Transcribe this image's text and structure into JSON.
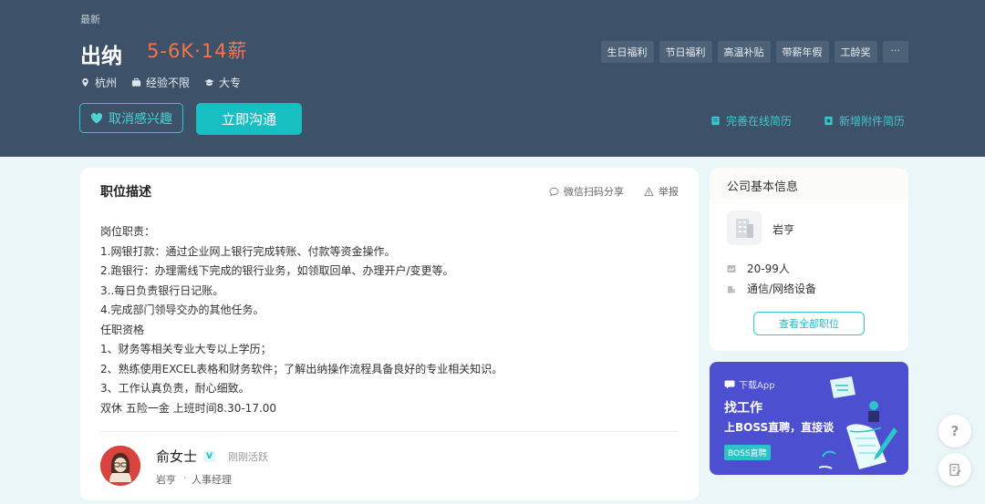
{
  "header": {
    "badge": "最新",
    "title": "出纳",
    "salary": "5-6K·14薪",
    "tags": [
      "生日福利",
      "节日福利",
      "高温补贴",
      "带薪年假",
      "工龄奖"
    ],
    "more_tags": "···",
    "location": "杭州",
    "experience": "经验不限",
    "education": "大专",
    "uninterest_button": "取消感兴趣",
    "chat_button": "立即沟通",
    "improve_resume": "完善在线简历",
    "add_attachment": "新增附件简历"
  },
  "job": {
    "section_title": "职位描述",
    "share": "微信扫码分享",
    "report": "举报",
    "description": [
      "岗位职责：",
      "1.网银打款：通过企业网上银行完成转账、付款等资金操作。",
      "2.跑银行：办理需线下完成的银行业务，如领取回单、办理开户/变更等。",
      "3..每日负责银行日记账。",
      "4.完成部门领导交办的其他任务。",
      "任职资格",
      "1、财务等相关专业大专以上学历；",
      "2、熟练使用EXCEL表格和财务软件；了解出纳操作流程具备良好的专业相关知识。",
      "3、工作认真负责，耐心细致。",
      "双休  五险一金  上班时间8.30-17.00"
    ]
  },
  "recruiter": {
    "name": "俞女士",
    "status": "刚刚活跃",
    "company": "岩亨",
    "separator": "·",
    "role": "人事经理"
  },
  "company": {
    "section_title": "公司基本信息",
    "name": "岩亨",
    "size": "20-99人",
    "industry": "通信/网络设备",
    "all_jobs_button": "查看全部职位"
  },
  "app_promo": {
    "download": "下载App",
    "title": "找工作",
    "subtitle": "上BOSS直聘，直接谈",
    "badge": "BOSS直聘"
  },
  "float": {
    "help": "?"
  },
  "colors": {
    "header_bg": "#3d5168",
    "accent": "#18bfc2",
    "salary": "#f5744a",
    "promo_bg": "#4b4fd0"
  }
}
